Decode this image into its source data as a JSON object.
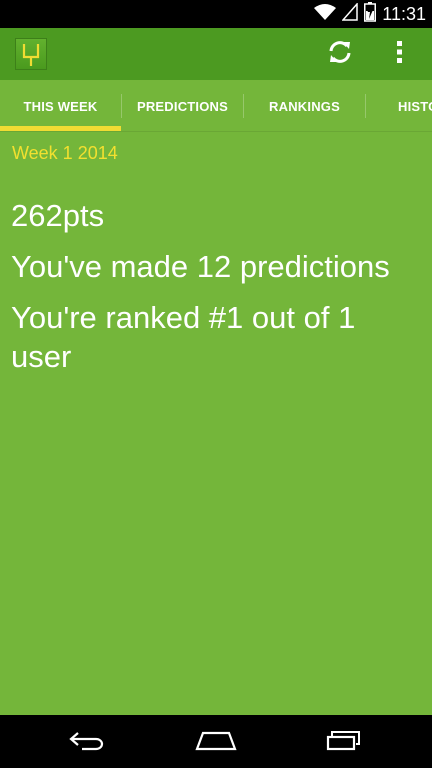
{
  "status_bar": {
    "time": "11:31",
    "icons": [
      "wifi-icon",
      "signal-icon",
      "battery-icon"
    ]
  },
  "action_bar": {
    "app_icon": "goalpost-icon",
    "actions": [
      "refresh-icon",
      "overflow-menu-icon"
    ]
  },
  "tabs": [
    {
      "label": "THIS WEEK",
      "selected": true
    },
    {
      "label": "PREDICTIONS",
      "selected": false
    },
    {
      "label": "RANKINGS",
      "selected": false
    },
    {
      "label": "HISTO",
      "selected": false
    }
  ],
  "content": {
    "week": "Week 1 2014",
    "points": "262pts",
    "predictions": "You've made 12 predictions",
    "ranked": "You're ranked #1 out of 1 user"
  },
  "nav_bar": {
    "buttons": [
      "back-icon",
      "home-icon",
      "recents-icon"
    ]
  },
  "colors": {
    "background": "#74b63a",
    "action_bar": "#4c9a21",
    "accent": "#f0dc33",
    "text": "#ffffff"
  }
}
